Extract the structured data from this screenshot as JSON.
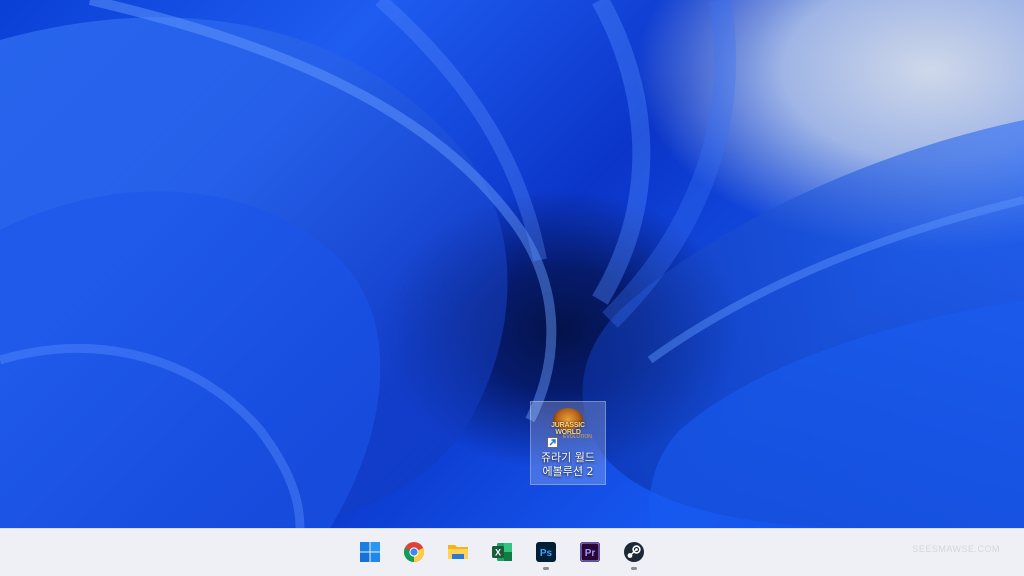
{
  "desktop": {
    "icons": [
      {
        "label_line1": "쥬라기 월드",
        "label_line2": "에볼루션 2",
        "logo_text": "JURASSIC WORLD",
        "logo_sub": "EVOLUTION"
      }
    ]
  },
  "taskbar": {
    "apps": [
      {
        "name": "start",
        "icon": "windows-start-icon",
        "running": false
      },
      {
        "name": "chrome",
        "icon": "chrome-icon",
        "running": false
      },
      {
        "name": "file-explorer",
        "icon": "folder-icon",
        "running": false
      },
      {
        "name": "excel",
        "icon": "excel-icon",
        "running": false,
        "glyph": "X"
      },
      {
        "name": "photoshop",
        "icon": "photoshop-icon",
        "running": true,
        "glyph": "Ps"
      },
      {
        "name": "premiere",
        "icon": "premiere-icon",
        "running": false,
        "glyph": "Pr"
      },
      {
        "name": "steam",
        "icon": "steam-icon",
        "running": true
      }
    ],
    "watermark": "SEESMAWSE.COM"
  },
  "colors": {
    "wallpaper_primary": "#0b3fd4",
    "taskbar_bg": "#eef0f5",
    "excel": "#1d6f42",
    "photoshop": "#31a8ff",
    "premiere": "#9999ff",
    "steam": "#1b2838"
  }
}
